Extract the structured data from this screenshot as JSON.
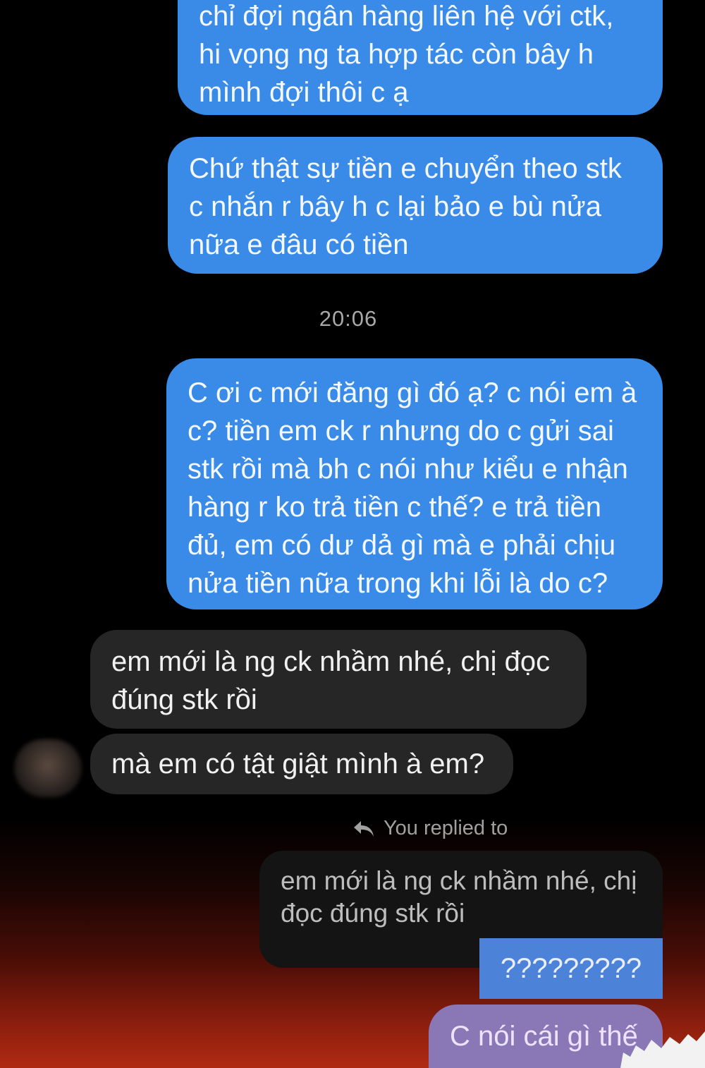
{
  "timestamp": "20:06",
  "reply_note": "You replied to",
  "messages": [
    {
      "sender": "me",
      "text": "chỉ đợi ngân hàng liên hệ với ctk,\nhi vọng ng ta hợp tác còn bây h\nmình đợi thôi c ạ"
    },
    {
      "sender": "me",
      "text": "Chứ thật sự tiền e chuyển theo stk\nc nhắn r bây h c lại bảo e bù nửa\nnữa e đâu có tiền"
    },
    {
      "sender": "me",
      "text": "C ơi c mới đăng gì đó ạ? c nói em à\nc? tiền em ck r nhưng do c gửi sai\nstk rồi mà bh c nói như kiểu e nhận\nhàng r ko trả tiền c thế? e trả tiền\nđủ, em có dư dả gì mà e phải chịu\nnửa tiền nữa trong khi lỗi là do c?"
    },
    {
      "sender": "them",
      "text": "em mới là ng ck nhầm nhé, chị đọc\nđúng stk rồi"
    },
    {
      "sender": "them",
      "text": "mà em có tật giật mình à em?"
    },
    {
      "sender": "quoted",
      "text": "em mới là ng ck nhầm nhé, chị\nđọc đúng stk rồi"
    },
    {
      "sender": "me",
      "text": "?????????"
    },
    {
      "sender": "me",
      "text": "C nói cái gì thế"
    }
  ],
  "colors": {
    "sent_bubble": "#3a8be8",
    "received_bubble": "#262626",
    "background": "#000000"
  },
  "icons": {
    "reply": "reply-arrow-icon",
    "avatar": "avatar-blurred"
  }
}
